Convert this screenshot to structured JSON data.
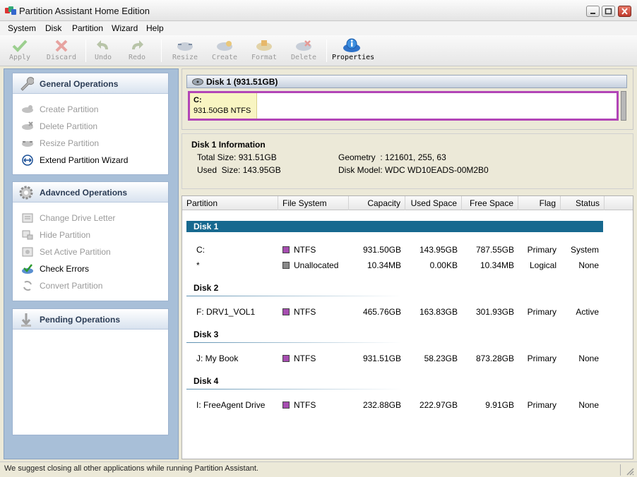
{
  "window": {
    "title": "Partition Assistant Home Edition"
  },
  "menu": [
    "System",
    "Disk",
    "Partition",
    "Wizard",
    "Help"
  ],
  "toolbar": {
    "apply": "Apply",
    "discard": "Discard",
    "undo": "Undo",
    "redo": "Redo",
    "resize": "Resize",
    "create": "Create",
    "format": "Format",
    "delete": "Delete",
    "properties": "Properties"
  },
  "sidebar": {
    "general": {
      "title": "General Operations",
      "items": [
        "Create Partition",
        "Delete Partition",
        "Resize Partition",
        "Extend Partition Wizard"
      ]
    },
    "advanced": {
      "title": "Adavnced Operations",
      "items": [
        "Change Drive Letter",
        "Hide Partition",
        "Set Active Partition",
        "Check Errors",
        "Convert Partition"
      ]
    },
    "pending": {
      "title": "Pending Operations"
    }
  },
  "diskmap": {
    "title": "Disk 1 (931.51GB)",
    "partition_letter": "C:",
    "partition_desc": "931.50GB NTFS"
  },
  "diskinfo": {
    "title": "Disk 1 Information",
    "total_size": "Total Size: 931.51GB",
    "used_size": "Used  Size: 143.95GB",
    "geometry": "Geometry  : 121601, 255, 63",
    "model": "Disk Model: WDC WD10EADS-00M2B0"
  },
  "table": {
    "columns": [
      "Partition",
      "File System",
      "Capacity",
      "Used Space",
      "Free Space",
      "Flag",
      "Status"
    ],
    "disks": [
      {
        "name": "Disk 1",
        "rows": [
          {
            "partition": "C:",
            "fs": "NTFS",
            "capacity": "931.50GB",
            "used": "143.95GB",
            "free": "787.55GB",
            "flag": "Primary",
            "status": "System"
          },
          {
            "partition": "*",
            "fs": "Unallocated",
            "capacity": "10.34MB",
            "used": "0.00KB",
            "free": "10.34MB",
            "flag": "Logical",
            "status": "None"
          }
        ]
      },
      {
        "name": "Disk 2",
        "rows": [
          {
            "partition": "F:  DRV1_VOL1",
            "fs": "NTFS",
            "capacity": "465.76GB",
            "used": "163.83GB",
            "free": "301.93GB",
            "flag": "Primary",
            "status": "Active"
          }
        ]
      },
      {
        "name": "Disk 3",
        "rows": [
          {
            "partition": "J:  My Book",
            "fs": "NTFS",
            "capacity": "931.51GB",
            "used": "58.23GB",
            "free": "873.28GB",
            "flag": "Primary",
            "status": "None"
          }
        ]
      },
      {
        "name": "Disk 4",
        "rows": [
          {
            "partition": "I:  FreeAgent Drive",
            "fs": "NTFS",
            "capacity": "232.88GB",
            "used": "222.97GB",
            "free": "9.91GB",
            "flag": "Primary",
            "status": "None"
          }
        ]
      }
    ]
  },
  "status": {
    "message": "We suggest closing all other applications while running Partition Assistant."
  },
  "colors": {
    "ntfs": "#a64db0",
    "unallocated": "#8a8a8a",
    "selected_disk": "#17698f",
    "partition_border": "#b245b7"
  }
}
